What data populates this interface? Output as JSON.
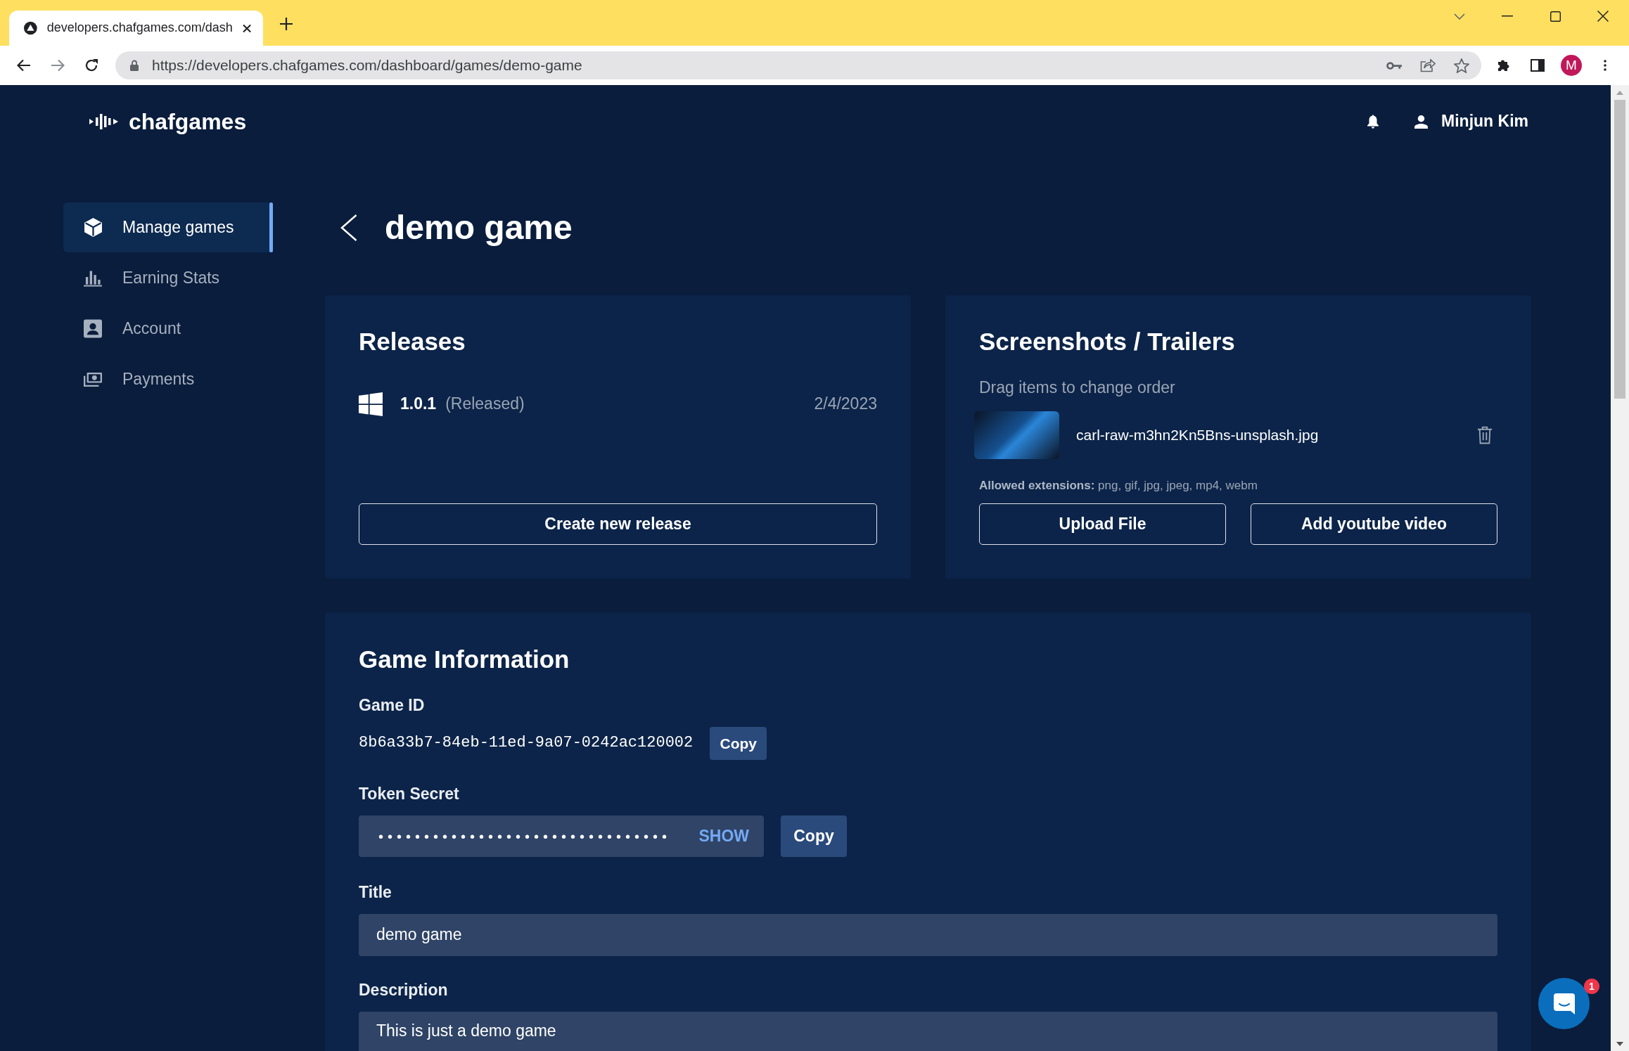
{
  "browser": {
    "tab": {
      "title": "developers.chafgames.com/dash"
    },
    "url": "https://developers.chafgames.com/dashboard/games/demo-game",
    "profile_initial": "M"
  },
  "header": {
    "brand": "chafgames",
    "user_name": "Minjun Kim"
  },
  "sidebar": {
    "items": [
      {
        "label": "Manage games",
        "selected": true
      },
      {
        "label": "Earning Stats",
        "selected": false
      },
      {
        "label": "Account",
        "selected": false
      },
      {
        "label": "Payments",
        "selected": false
      }
    ]
  },
  "page": {
    "title": "demo game"
  },
  "releases": {
    "heading": "Releases",
    "items": [
      {
        "version": "1.0.1",
        "status": "(Released)",
        "date": "2/4/2023"
      }
    ],
    "button": "Create new release"
  },
  "media": {
    "heading": "Screenshots / Trailers",
    "hint": "Drag items to change order",
    "files": [
      {
        "name": "carl-raw-m3hn2Kn5Bns-unsplash.jpg"
      }
    ],
    "extensions_note": "**Allowed extensions:** png, gif, jpg, jpeg, mp4, webm",
    "buttons": [
      "Upload File",
      "Add youtube video"
    ]
  },
  "game_info": {
    "heading": "Game Information",
    "game_id": {
      "label": "Game ID",
      "value": "8b6a33b7-84eb-11ed-9a07-0242ac120002",
      "button": "Copy"
    },
    "token_secret": {
      "label": "Token Secret",
      "value": "••••••••••••••••••••••••••••••••",
      "toggle": "SHOW",
      "button": "Copy"
    },
    "title": {
      "label": "Title",
      "value": "demo game"
    },
    "description": {
      "label": "Description",
      "value": "This is just a demo game"
    }
  },
  "chat": {
    "badge": "1"
  }
}
